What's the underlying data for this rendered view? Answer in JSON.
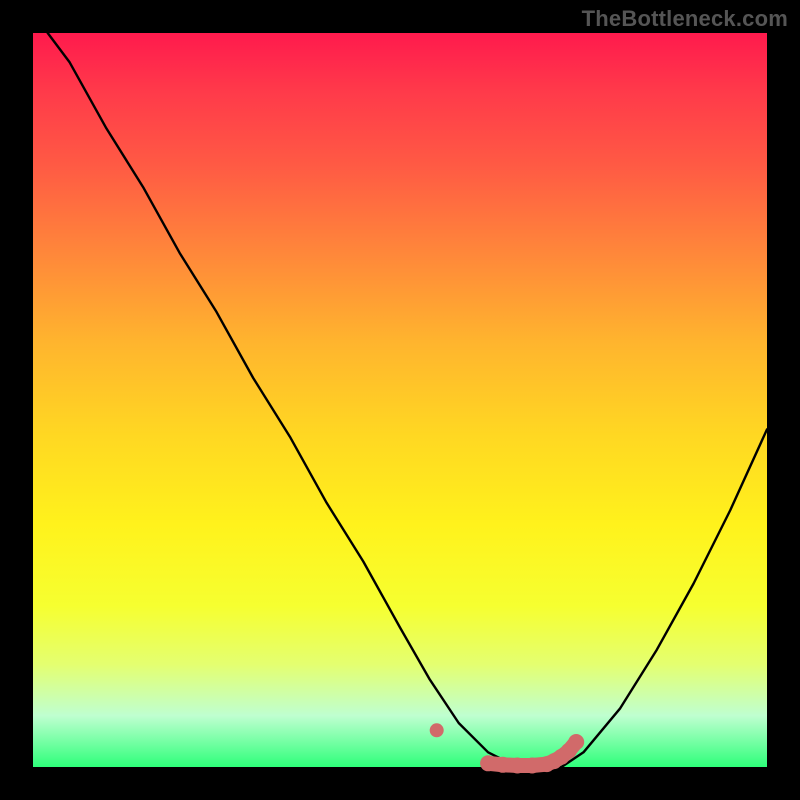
{
  "watermark": "TheBottleneck.com",
  "colors": {
    "background": "#000000",
    "gradient_top": "#ff1a4d",
    "gradient_bottom": "#2eff7a",
    "curve": "#000000",
    "highlight": "#d16a6a"
  },
  "chart_data": {
    "type": "line",
    "title": "",
    "xlabel": "",
    "ylabel": "",
    "xlim": [
      0,
      100
    ],
    "ylim": [
      0,
      100
    ],
    "series": [
      {
        "name": "curve",
        "x": [
          2,
          5,
          10,
          15,
          20,
          25,
          30,
          35,
          40,
          45,
          50,
          54,
          58,
          62,
          66,
          70,
          72,
          75,
          80,
          85,
          90,
          95,
          100
        ],
        "y": [
          100,
          96,
          87,
          79,
          70,
          62,
          53,
          45,
          36,
          28,
          19,
          12,
          6,
          2,
          0,
          0,
          0,
          2,
          8,
          16,
          25,
          35,
          46
        ]
      }
    ],
    "highlight": {
      "name": "flat-min-dots",
      "x": [
        55,
        62,
        64,
        66,
        68,
        70,
        71,
        72,
        73,
        74
      ],
      "y": [
        5,
        0.5,
        0.3,
        0.2,
        0.2,
        0.4,
        0.8,
        1.4,
        2.2,
        3.4
      ]
    }
  }
}
